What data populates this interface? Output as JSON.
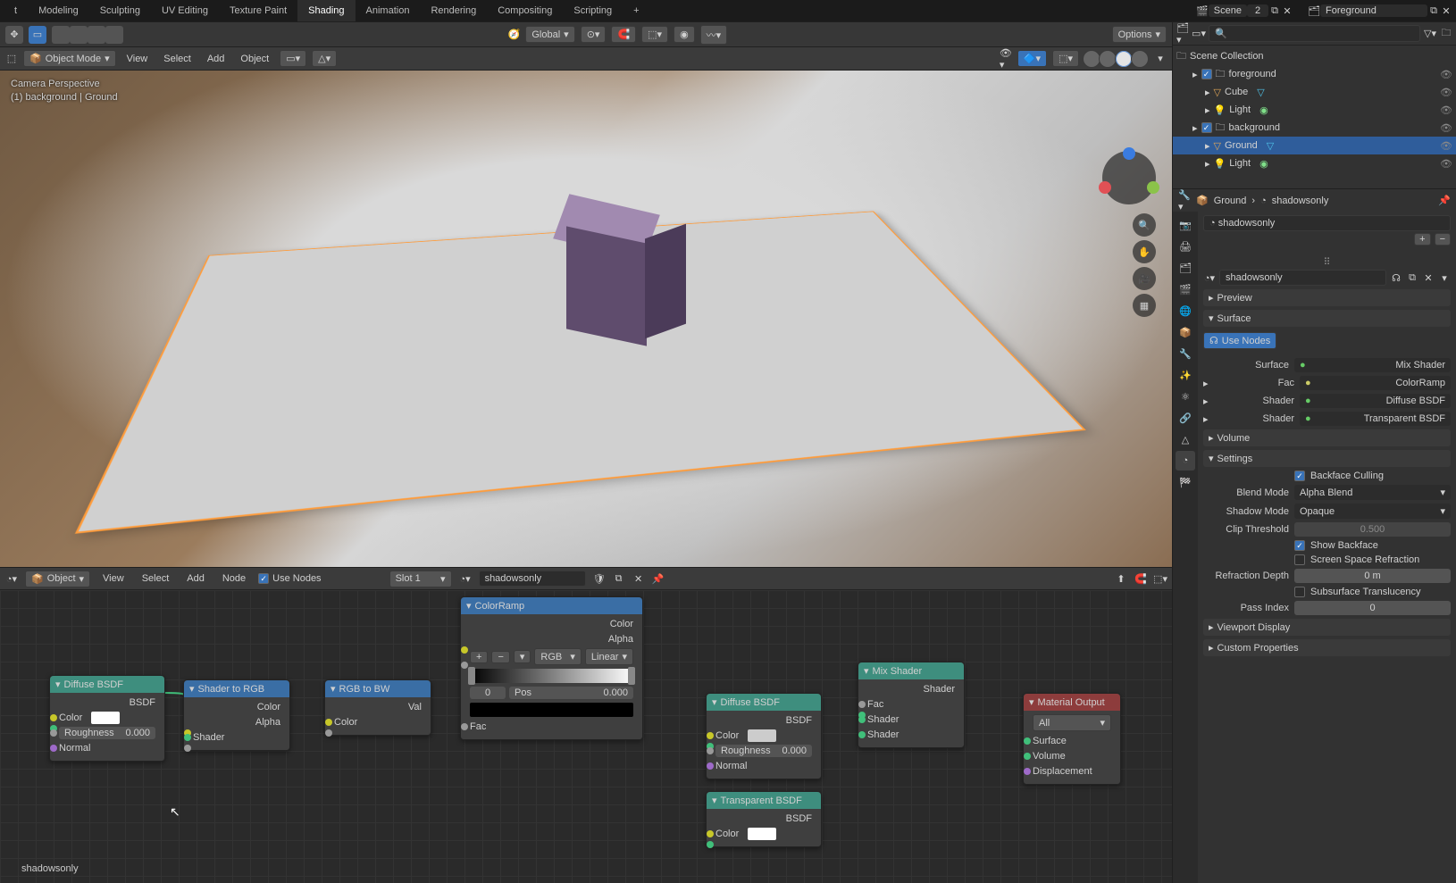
{
  "topbar": {
    "tabs": [
      "t",
      "Modeling",
      "Sculpting",
      "UV Editing",
      "Texture Paint",
      "Shading",
      "Animation",
      "Rendering",
      "Compositing",
      "Scripting"
    ],
    "scene": "Scene",
    "scene_count": "2",
    "layer": "Foreground"
  },
  "header2": {
    "orientation": "Global",
    "options": "Options"
  },
  "viewport": {
    "mode": "Object Mode",
    "menus": [
      "View",
      "Select",
      "Add",
      "Object"
    ],
    "overlay_line1": "Camera Perspective",
    "overlay_line2": "(1) background | Ground"
  },
  "nodeeditor": {
    "mode": "Object",
    "menus": [
      "View",
      "Select",
      "Add",
      "Node"
    ],
    "use_nodes": "Use Nodes",
    "slot": "Slot 1",
    "material": "shadowsonly",
    "footer": "shadowsonly"
  },
  "nodes": {
    "diffuse1": {
      "title": "Diffuse BSDF",
      "bsdf": "BSDF",
      "color": "Color",
      "rough": "Roughness",
      "roughv": "0.000",
      "normal": "Normal"
    },
    "shader2rgb": {
      "title": "Shader to RGB",
      "color": "Color",
      "alpha": "Alpha",
      "shader": "Shader"
    },
    "rgb2bw": {
      "title": "RGB to BW",
      "val": "Val",
      "color": "Color"
    },
    "colorramp": {
      "title": "ColorRamp",
      "color": "Color",
      "alpha": "Alpha",
      "mode": "RGB",
      "interp": "Linear",
      "pos_l": "0",
      "pos_lbl": "Pos",
      "pos_r": "0.000",
      "fac": "Fac"
    },
    "diffuse2": {
      "title": "Diffuse BSDF",
      "bsdf": "BSDF",
      "color": "Color",
      "rough": "Roughness",
      "roughv": "0.000",
      "normal": "Normal"
    },
    "transp": {
      "title": "Transparent BSDF",
      "bsdf": "BSDF",
      "color": "Color"
    },
    "mix": {
      "title": "Mix Shader",
      "shader": "Shader",
      "fac": "Fac",
      "sh1": "Shader",
      "sh2": "Shader"
    },
    "output": {
      "title": "Material Output",
      "target": "All",
      "surface": "Surface",
      "volume": "Volume",
      "disp": "Displacement"
    }
  },
  "outliner": {
    "root": "Scene Collection",
    "items": [
      {
        "indent": 1,
        "name": "foreground",
        "type": "collection",
        "checked": true
      },
      {
        "indent": 2,
        "name": "Cube",
        "type": "mesh"
      },
      {
        "indent": 2,
        "name": "Light",
        "type": "light"
      },
      {
        "indent": 1,
        "name": "background",
        "type": "collection",
        "checked": true
      },
      {
        "indent": 2,
        "name": "Ground",
        "type": "mesh",
        "selected": true
      },
      {
        "indent": 2,
        "name": "Light",
        "type": "light"
      }
    ]
  },
  "prop_hdr": {
    "obj": "Ground",
    "mat": "shadowsonly"
  },
  "props": {
    "mat_search": "shadowsonly",
    "mat_name": "shadowsonly",
    "preview": "Preview",
    "surface": "Surface",
    "use_nodes_btn": "Use Nodes",
    "surface_row": "Surface",
    "surface_val": "Mix Shader",
    "fac": "Fac",
    "fac_val": "ColorRamp",
    "shader1": "Shader",
    "shader1_val": "Diffuse BSDF",
    "shader2": "Shader",
    "shader2_val": "Transparent BSDF",
    "volume": "Volume",
    "settings": "Settings",
    "backface": "Backface Culling",
    "blend": "Blend Mode",
    "blend_val": "Alpha Blend",
    "shadow": "Shadow Mode",
    "shadow_val": "Opaque",
    "clip": "Clip Threshold",
    "clip_val": "0.500",
    "show_back": "Show Backface",
    "ssr": "Screen Space Refraction",
    "refr_depth": "Refraction Depth",
    "refr_depth_val": "0 m",
    "subs": "Subsurface Translucency",
    "pass": "Pass Index",
    "pass_val": "0",
    "vp": "Viewport Display",
    "custom": "Custom Properties"
  }
}
